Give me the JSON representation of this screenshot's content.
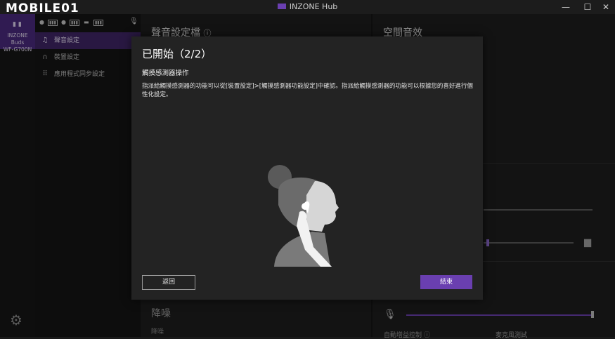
{
  "window": {
    "title": "INZONE Hub",
    "minimize": "—",
    "maximize": "☐",
    "close": "✕"
  },
  "brand": {
    "logo_text": "MOBILE01"
  },
  "device": {
    "name_line1": "INZONE Buds",
    "name_line2": "WF-G700N"
  },
  "nav": {
    "items": [
      {
        "label": "聲音設定",
        "icon": "music-note-icon"
      },
      {
        "label": "裝置設定",
        "icon": "headphones-icon"
      },
      {
        "label": "應用程式同步設定",
        "icon": "grid-icon"
      }
    ]
  },
  "main": {
    "sound_profile_title": "聲音設定檔",
    "spatial_title": "空間音效",
    "noise_cancel_title": "降噪",
    "noise_cancel_sub": "降噪",
    "agc_label": "自動增益控制",
    "mic_test_label": "麥克風測試"
  },
  "modal": {
    "title": "已開始（2/2）",
    "subtitle": "觸摸感測器操作",
    "description": "指派給觸摸感測器的功能可以從[裝置設定]>[觸摸感測器功能設定]中確認。指派給觸摸感測器的功能可以根據您的喜好進行個性化設定。",
    "back_label": "返回",
    "finish_label": "結束"
  },
  "colors": {
    "accent": "#6a3fb0",
    "nav_selected": "#3f2566"
  }
}
